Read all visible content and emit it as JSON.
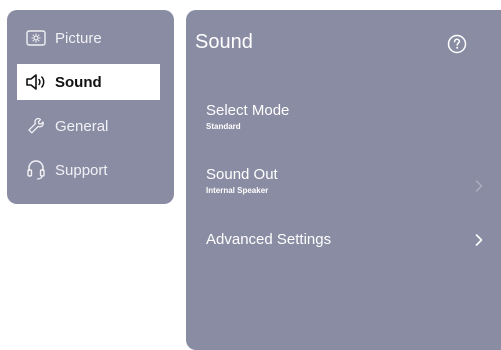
{
  "sidebar": {
    "items": [
      {
        "label": "Picture",
        "icon": "picture-icon",
        "active": false
      },
      {
        "label": "Sound",
        "icon": "speaker-icon",
        "active": true
      },
      {
        "label": "General",
        "icon": "wrench-icon",
        "active": false
      },
      {
        "label": "Support",
        "icon": "headset-icon",
        "active": false
      }
    ]
  },
  "main": {
    "title": "Sound",
    "help_icon": "help-icon",
    "settings": [
      {
        "label": "Select Mode",
        "value": "Standard",
        "chevron": false
      },
      {
        "label": "Sound Out",
        "value": "Internal Speaker",
        "chevron": true,
        "chevron_dim": true
      },
      {
        "label": "Advanced Settings",
        "value": "",
        "chevron": true,
        "chevron_dim": false
      }
    ]
  },
  "colors": {
    "panel": "#8a8ca3",
    "active_bg": "#ffffff",
    "text": "#ffffff",
    "active_text": "#111111"
  }
}
